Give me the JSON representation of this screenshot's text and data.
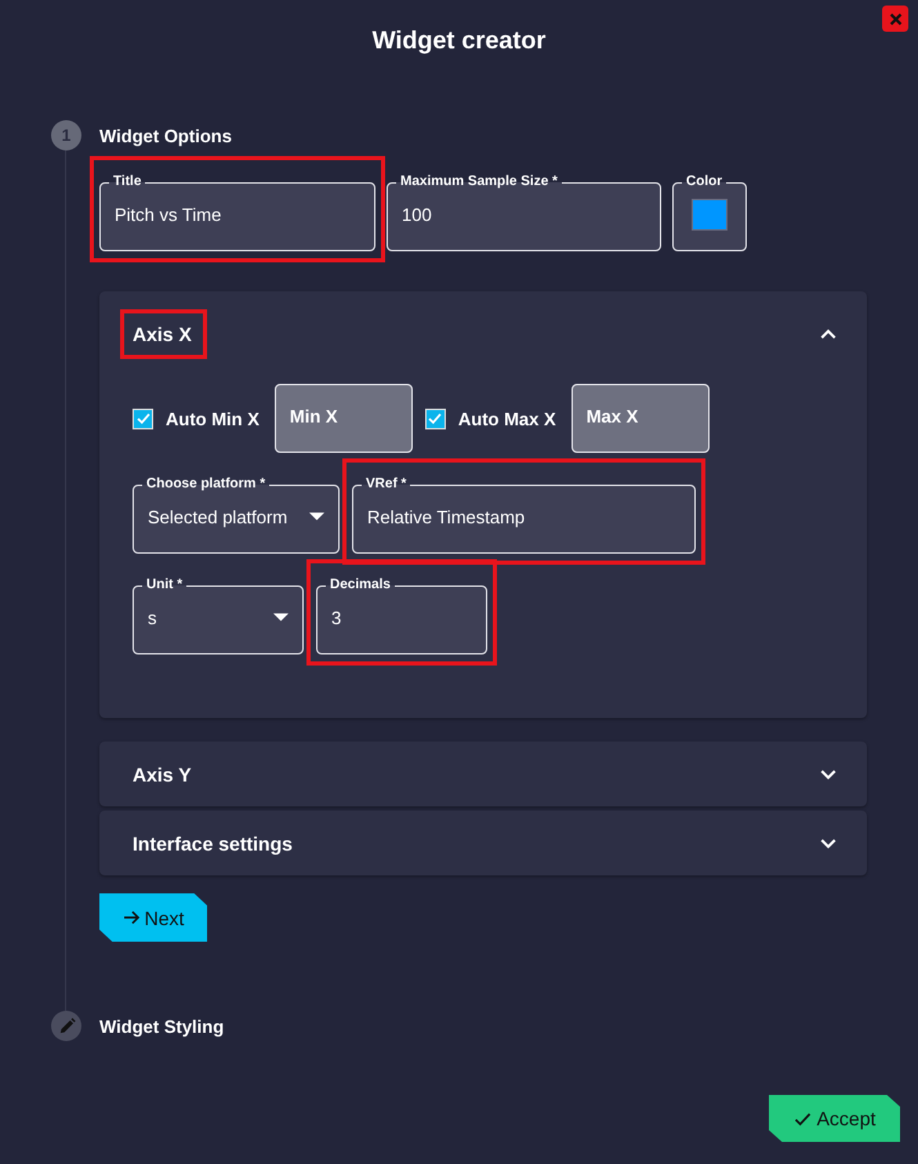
{
  "dialog": {
    "title": "Widget creator"
  },
  "steps": [
    {
      "kind": "number",
      "marker": "1",
      "label": "Widget Options"
    },
    {
      "kind": "pencil",
      "label": "Widget Styling"
    }
  ],
  "options": {
    "fields": [
      {
        "kind": "text",
        "label": "Title",
        "value": "Pitch vs Time",
        "highlighted": true
      },
      {
        "kind": "text",
        "label": "Maximum Sample Size *",
        "value": "100",
        "highlighted": false
      },
      {
        "kind": "color",
        "label": "Color",
        "color": "#0096ff",
        "highlighted": false
      }
    ]
  },
  "sections": [
    {
      "title": "Axis X",
      "expanded": true,
      "highlighted": true,
      "rows": [
        [
          {
            "kind": "checkbox",
            "label": "Auto Min X",
            "checked": true
          },
          {
            "kind": "text",
            "placeholder": "Min X",
            "disabled": true,
            "highlighted": false
          },
          {
            "kind": "checkbox",
            "label": "Auto Max X",
            "checked": true
          },
          {
            "kind": "text",
            "placeholder": "Max X",
            "disabled": true,
            "highlighted": false
          }
        ],
        [
          {
            "kind": "select",
            "label": "Choose platform *",
            "value": "Selected platform",
            "highlighted": false
          },
          {
            "kind": "text",
            "label": "VRef *",
            "value": "Relative Timestamp",
            "disabled": false,
            "highlighted": true
          }
        ],
        [
          {
            "kind": "select",
            "label": "Unit *",
            "value": "s",
            "highlighted": false
          },
          {
            "kind": "text",
            "label": "Decimals",
            "value": "3",
            "disabled": false,
            "highlighted": true
          }
        ]
      ]
    },
    {
      "title": "Axis Y",
      "expanded": false,
      "highlighted": false
    },
    {
      "title": "Interface settings",
      "expanded": false,
      "highlighted": false
    }
  ],
  "next_button": {
    "label": "Next"
  },
  "accept_button": {
    "label": "Accept"
  }
}
